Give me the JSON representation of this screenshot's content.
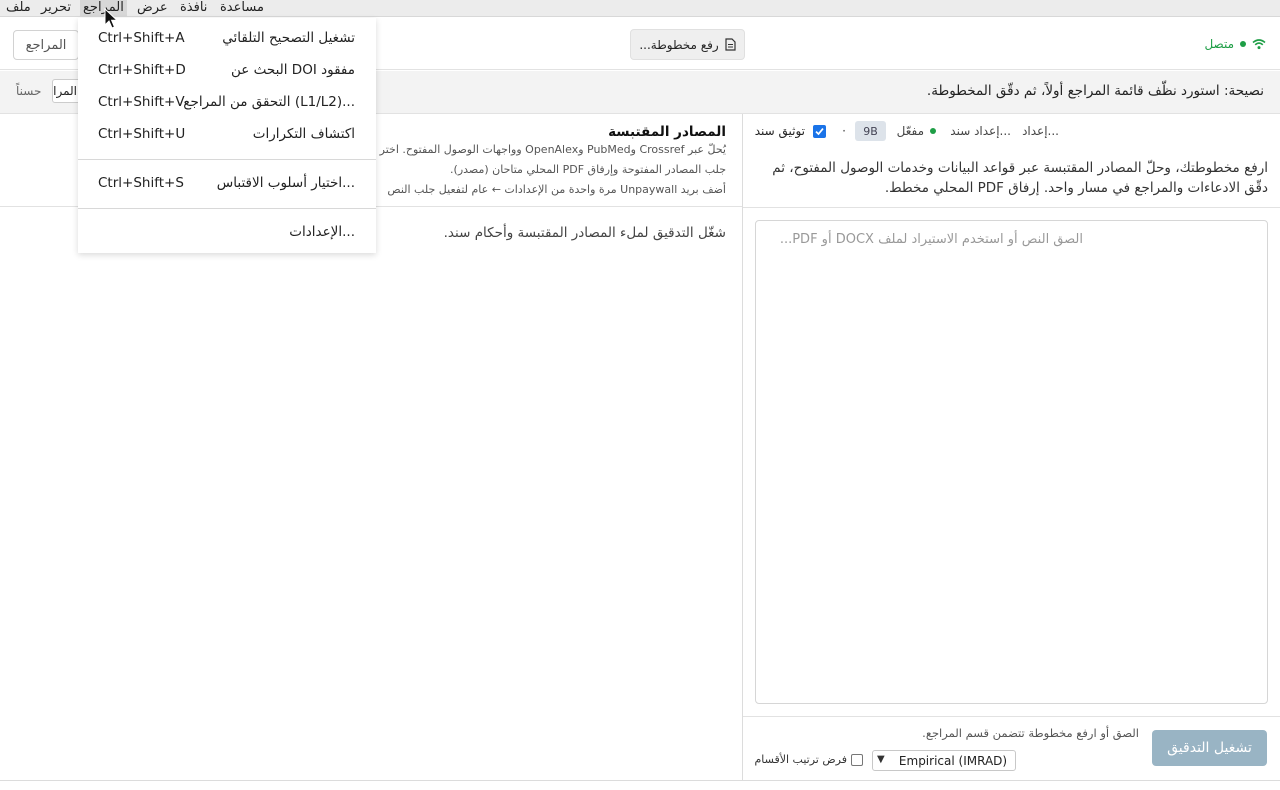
{
  "menubar": {
    "items": [
      "ملف",
      "تحرير",
      "المراجع",
      "عرض",
      "نافذة",
      "مساعدة"
    ],
    "active": "المراجع"
  },
  "header": {
    "status": "متصل",
    "upload_label": "رفع مخطوطة...",
    "references_tab": "المراجع"
  },
  "tipbar": {
    "text": "نصيحة: استورد نظّف قائمة المراجع أولاً، ثم دقّق المخطوطة.",
    "ok_label": "حسناً",
    "select_value": "المراجع"
  },
  "right_pane": {
    "citation_check_label": "توثيق سند",
    "citation_checked": true,
    "version_badge": "9B",
    "separator": "·",
    "status_enabled": "مفعّل",
    "setup_support": "إعداد سند...",
    "setup": "إعداد...",
    "description": "ارفع مخطوطتك، وحلّ المصادر المقتبسة عبر قواعد البيانات وخدمات الوصول المفتوح، ثم دقّق الادعاءات والمراجع في مسار واحد. إرفاق PDF المحلي مخطط.",
    "placeholder": "الصق النص أو استخدم الاستيراد لملف DOCX أو PDF...",
    "run_button": "تشغيل التدقيق",
    "hint": "الصق أو ارفع مخطوطة تتضمن قسم المراجع.",
    "mode_value": "Empirical (IMRAD)",
    "section_order_label": "فرض ترتيب الأقسام",
    "section_order_checked": false
  },
  "left_pane": {
    "title": "المصادر المقتبسة",
    "line1": "يُحلّ عبر Crossref وPubMed وOpenAlex وواجهات الوصول المفتوح. اختر",
    "line2": "جلب المصادر المفتوحة وإرفاق PDF المحلي متاحان (مصدر).",
    "line3": "أضف بريد Unpaywall مرة واحدة من الإعدادات ← عام لتفعيل جلب النص",
    "empty_state": "شغّل التدقيق لملء المصادر المقتبسة وأحكام سند."
  },
  "references_menu": {
    "items": [
      {
        "label": "تشغيل التصحيح التلقائي",
        "shortcut": "Ctrl+Shift+A"
      },
      {
        "label": "البحث عن DOI مفقود",
        "shortcut": "Ctrl+Shift+D"
      },
      {
        "label": "التحقق من المراجع (L1/L2)...",
        "shortcut": "Ctrl+Shift+V"
      },
      {
        "label": "اكتشاف التكرارات",
        "shortcut": "Ctrl+Shift+U"
      },
      {
        "label": "اختيار أسلوب الاقتباس...",
        "shortcut": "Ctrl+Shift+S"
      },
      {
        "label": "الإعدادات...",
        "shortcut": ""
      }
    ]
  },
  "colors": {
    "accent": "#1a73e8",
    "online": "#1e9e46",
    "run_button": "#99b4c4"
  },
  "icons": [
    "wifi-icon",
    "document-icon",
    "checkmark-icon",
    "chevron-down-icon",
    "mouse-cursor-icon"
  ]
}
